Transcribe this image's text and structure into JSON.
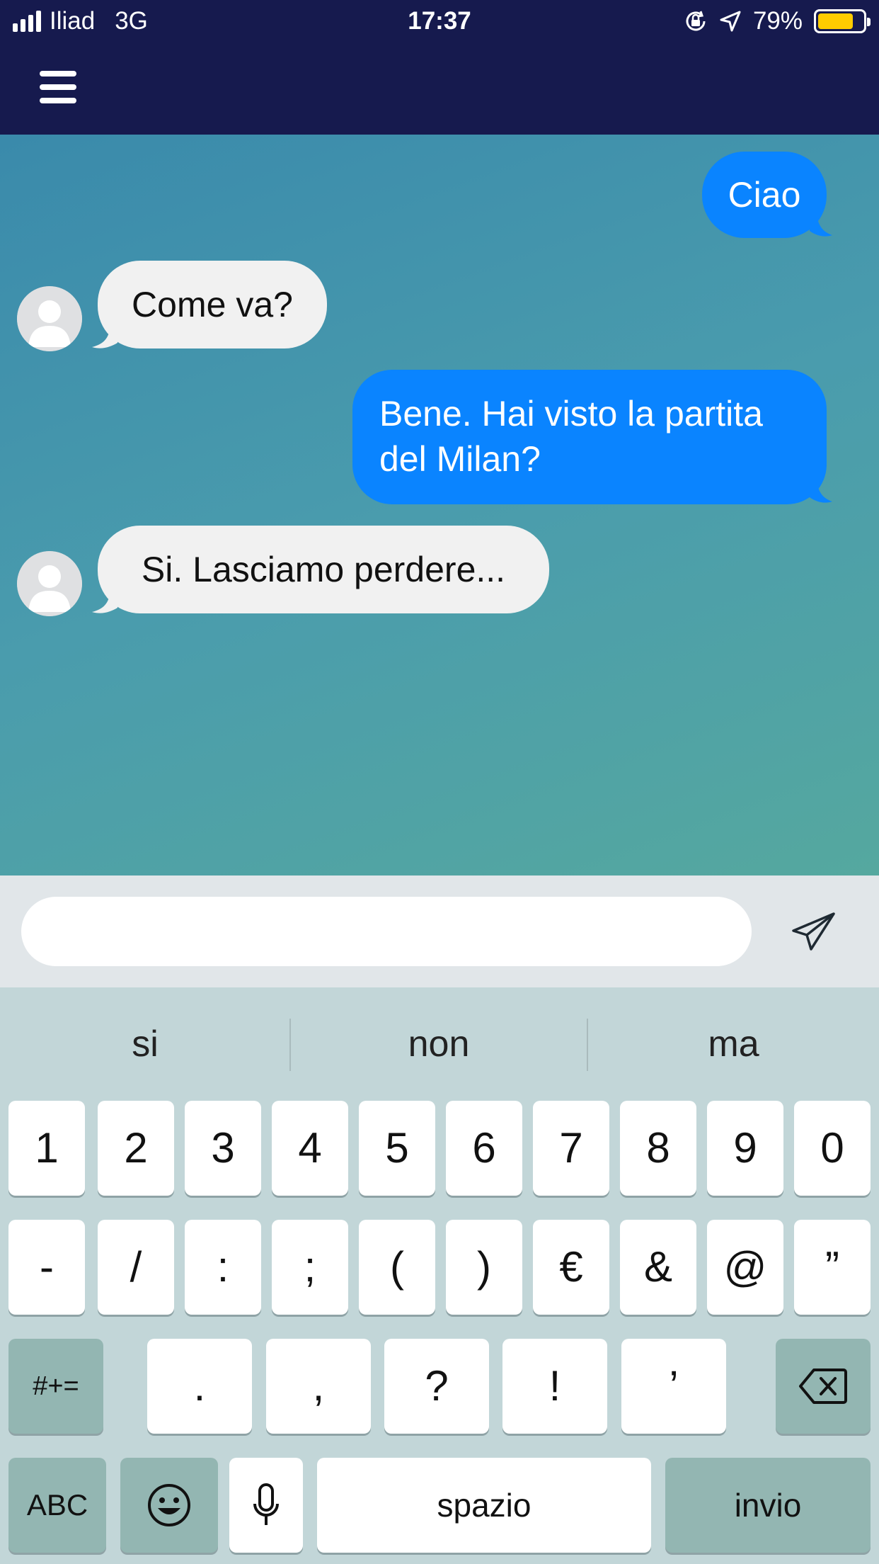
{
  "status_bar": {
    "carrier": "Iliad",
    "network": "3G",
    "time": "17:37",
    "battery": "79%",
    "battery_level": 0.79
  },
  "nav": {
    "menu_icon": "hamburger-menu-icon"
  },
  "messages": [
    {
      "direction": "outgoing",
      "text": "Ciao"
    },
    {
      "direction": "incoming",
      "text": "Come va?"
    },
    {
      "direction": "outgoing",
      "line1": "Bene. Hai visto la partita",
      "line2": "del Milan?"
    },
    {
      "direction": "incoming",
      "text": "Si. Lasciamo perdere..."
    }
  ],
  "composer": {
    "value": "",
    "placeholder": "",
    "send_icon": "paper-plane-icon"
  },
  "keyboard": {
    "suggestions": [
      "si",
      "non",
      "ma"
    ],
    "row1": [
      "1",
      "2",
      "3",
      "4",
      "5",
      "6",
      "7",
      "8",
      "9",
      "0"
    ],
    "row2": [
      "-",
      "/",
      ":",
      ";",
      "(",
      ")",
      "€",
      "&",
      "@",
      "”"
    ],
    "row3": {
      "toggle": "#+=",
      "keys": [
        ".",
        ",",
        "?",
        "!",
        "’"
      ],
      "delete_icon": "backspace-icon"
    },
    "row4": {
      "abc": "ABC",
      "emoji_icon": "emoji-icon",
      "mic_icon": "microphone-icon",
      "space": "spazio",
      "return": "invio"
    }
  },
  "colors": {
    "nav_background": "#161a4e",
    "outgoing_bubble": "#0a84ff",
    "incoming_bubble": "#f1f1f1",
    "battery_fill": "#ffcc00"
  }
}
